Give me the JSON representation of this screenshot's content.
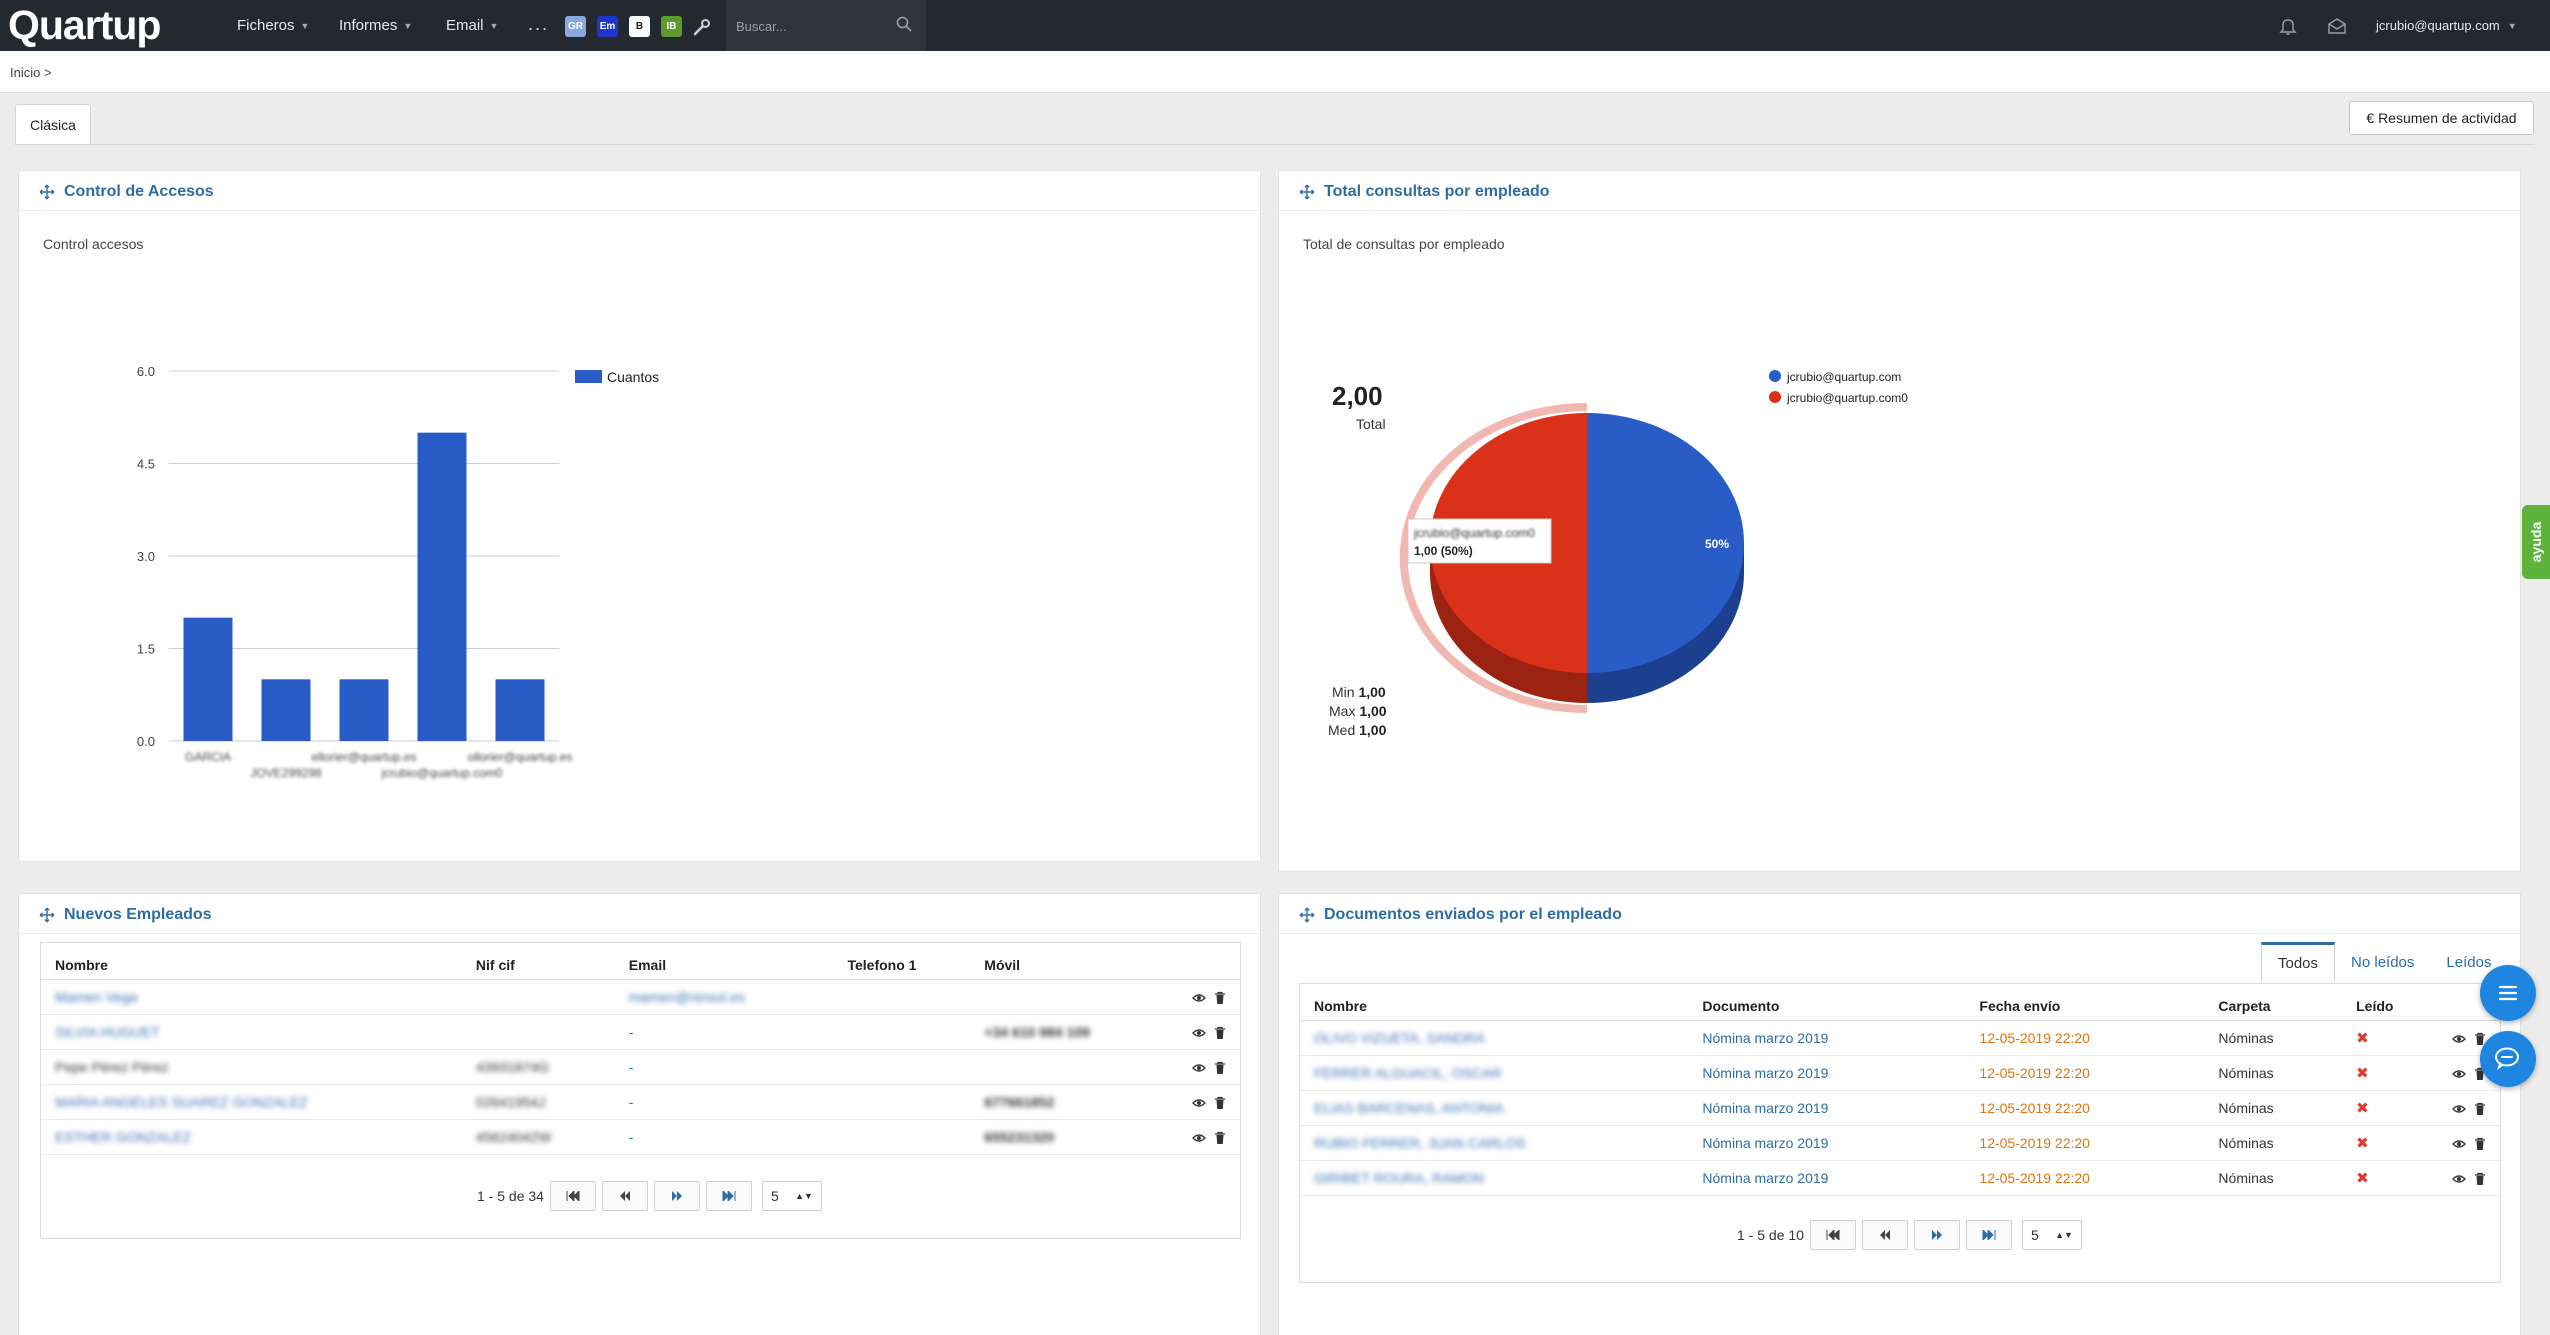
{
  "app": {
    "brand": "Quartup"
  },
  "nav": {
    "items": [
      {
        "label": "Ficheros"
      },
      {
        "label": "Informes"
      },
      {
        "label": "Email"
      }
    ],
    "more": "...",
    "quick_icons": [
      {
        "label": "GR",
        "color": "#8aa8e0"
      },
      {
        "label": "Em",
        "color": "#1d35c9"
      },
      {
        "label": "B",
        "color": "#ffffff"
      },
      {
        "label": "IB",
        "color": "#5e9a2c"
      }
    ],
    "search_placeholder": "Buscar...",
    "user": "jcrubio@quartup.com"
  },
  "breadcrumb": "Inicio >",
  "tabs": {
    "active": "Clásica"
  },
  "actions": {
    "resumen": "€ Resumen de actividad"
  },
  "panels": {
    "control": {
      "title": "Control de Accesos",
      "subtitle": "Control accesos"
    },
    "consultas": {
      "title": "Total consultas por empleado",
      "subtitle": "Total de consultas por empleado"
    },
    "empleados": {
      "title": "Nuevos Empleados"
    },
    "documentos": {
      "title": "Documentos enviados por el empleado"
    }
  },
  "chart_data": [
    {
      "type": "bar",
      "categories": [
        "GARCIA",
        "JOVE299298",
        "ellorier@quartup.es",
        "jcrubio@quartup.com0",
        "ollorier@quartup.es"
      ],
      "series": [
        {
          "name": "Cuantos",
          "values": [
            2,
            1,
            1,
            5,
            1
          ]
        }
      ],
      "y_ticks": [
        "0.0",
        "1.5",
        "3.0",
        "4.5",
        "6.0"
      ],
      "ylim": [
        0,
        6
      ],
      "color": "#2a5cc7",
      "legend": "top-right",
      "grid": true
    },
    {
      "type": "pie",
      "categories": [
        "jcrubio@quartup.com",
        "jcrubio@quartup.com0"
      ],
      "values": [
        1,
        1
      ],
      "colors": [
        "#2a5cc7",
        "#d93219"
      ],
      "slice_label": "50%",
      "total": "2,00",
      "total_label": "Total",
      "tooltip": {
        "name": "jcrubio@quartup.com0",
        "value": "1,00 (50%)"
      },
      "stats": [
        {
          "label": "Min",
          "value": "1,00"
        },
        {
          "label": "Max",
          "value": "1,00"
        },
        {
          "label": "Med",
          "value": "1,00"
        }
      ]
    }
  ],
  "empleados_table": {
    "headers": [
      "Nombre",
      "Nif cif",
      "Email",
      "Telefono 1",
      "Móvil"
    ],
    "rows": [
      {
        "nombre": "Mamen Vega",
        "nif": "",
        "email": "mamen@ninsol.es",
        "tel": "",
        "movil": ""
      },
      {
        "nombre": "SILVIA HUGUET",
        "nif": "",
        "email": "-",
        "tel": "",
        "movil": "+34 610 984 109"
      },
      {
        "nombre": "Pepe Pérez Pérez",
        "nif": "43931874G",
        "email": "-",
        "tel": "",
        "movil": ""
      },
      {
        "nombre": "MARIA ANGELES SUAREZ GONZALEZ",
        "nif": "02641954J",
        "email": "-",
        "tel": "",
        "movil": "677661852"
      },
      {
        "nombre": "ESTHER GONZALEZ",
        "nif": "45624042W",
        "email": "-",
        "tel": "",
        "movil": "655231320"
      }
    ],
    "pager": {
      "range": "1 - 5 de 34",
      "size": "5"
    }
  },
  "documentos_tabs": [
    "Todos",
    "No leídos",
    "Leídos"
  ],
  "documentos_table": {
    "headers": [
      "Nombre",
      "Documento",
      "Fecha envío",
      "Carpeta",
      "Leído"
    ],
    "rows": [
      {
        "nombre": "OLIVO VIZUETA, SANDRA",
        "doc": "Nómina marzo 2019",
        "fecha": "12-05-2019 22:20",
        "carpeta": "Nóminas"
      },
      {
        "nombre": "FERRER ALGUACIL, OSCAR",
        "doc": "Nómina marzo 2019",
        "fecha": "12-05-2019 22:20",
        "carpeta": "Nóminas"
      },
      {
        "nombre": "ELIAS BARCENAS, ANTONIA",
        "doc": "Nómina marzo 2019",
        "fecha": "12-05-2019 22:20",
        "carpeta": "Nóminas"
      },
      {
        "nombre": "RUBIO FERRER, JUAN CARLOS",
        "doc": "Nómina marzo 2019",
        "fecha": "12-05-2019 22:20",
        "carpeta": "Nóminas"
      },
      {
        "nombre": "GIRIBET ROURA, RAMON",
        "doc": "Nómina marzo 2019",
        "fecha": "12-05-2019 22:20",
        "carpeta": "Nóminas"
      }
    ],
    "pager": {
      "range": "1 - 5 de 10",
      "size": "5"
    }
  },
  "help": "ayuda"
}
